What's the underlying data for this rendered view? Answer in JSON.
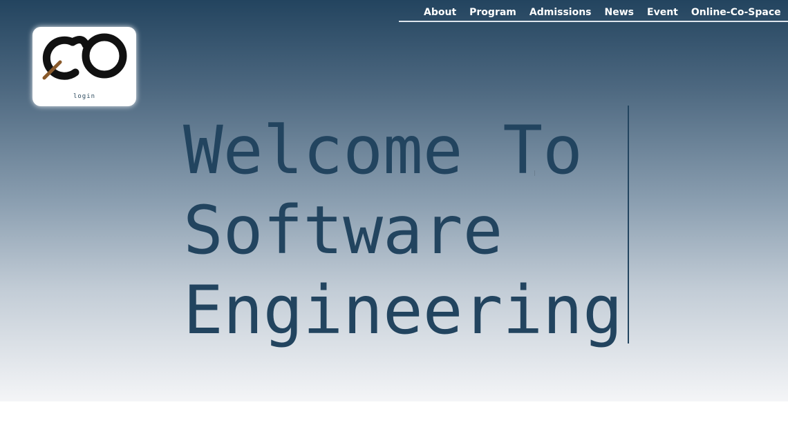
{
  "nav": {
    "items": [
      {
        "label": "About"
      },
      {
        "label": "Program"
      },
      {
        "label": "Admissions"
      },
      {
        "label": "News"
      },
      {
        "label": "Event"
      },
      {
        "label": "Online-Co-Space"
      }
    ]
  },
  "logo": {
    "icon": "infinity-co-logo-icon",
    "login_label": "login"
  },
  "hero": {
    "line1": "Welcome To",
    "line2": "Software",
    "line3": "Engineering"
  },
  "colors": {
    "primary_text": "#22445f",
    "gradient_top": "#23445f",
    "gradient_bottom": "#f4f5f7",
    "logo_accent": "#8a5a2b"
  }
}
